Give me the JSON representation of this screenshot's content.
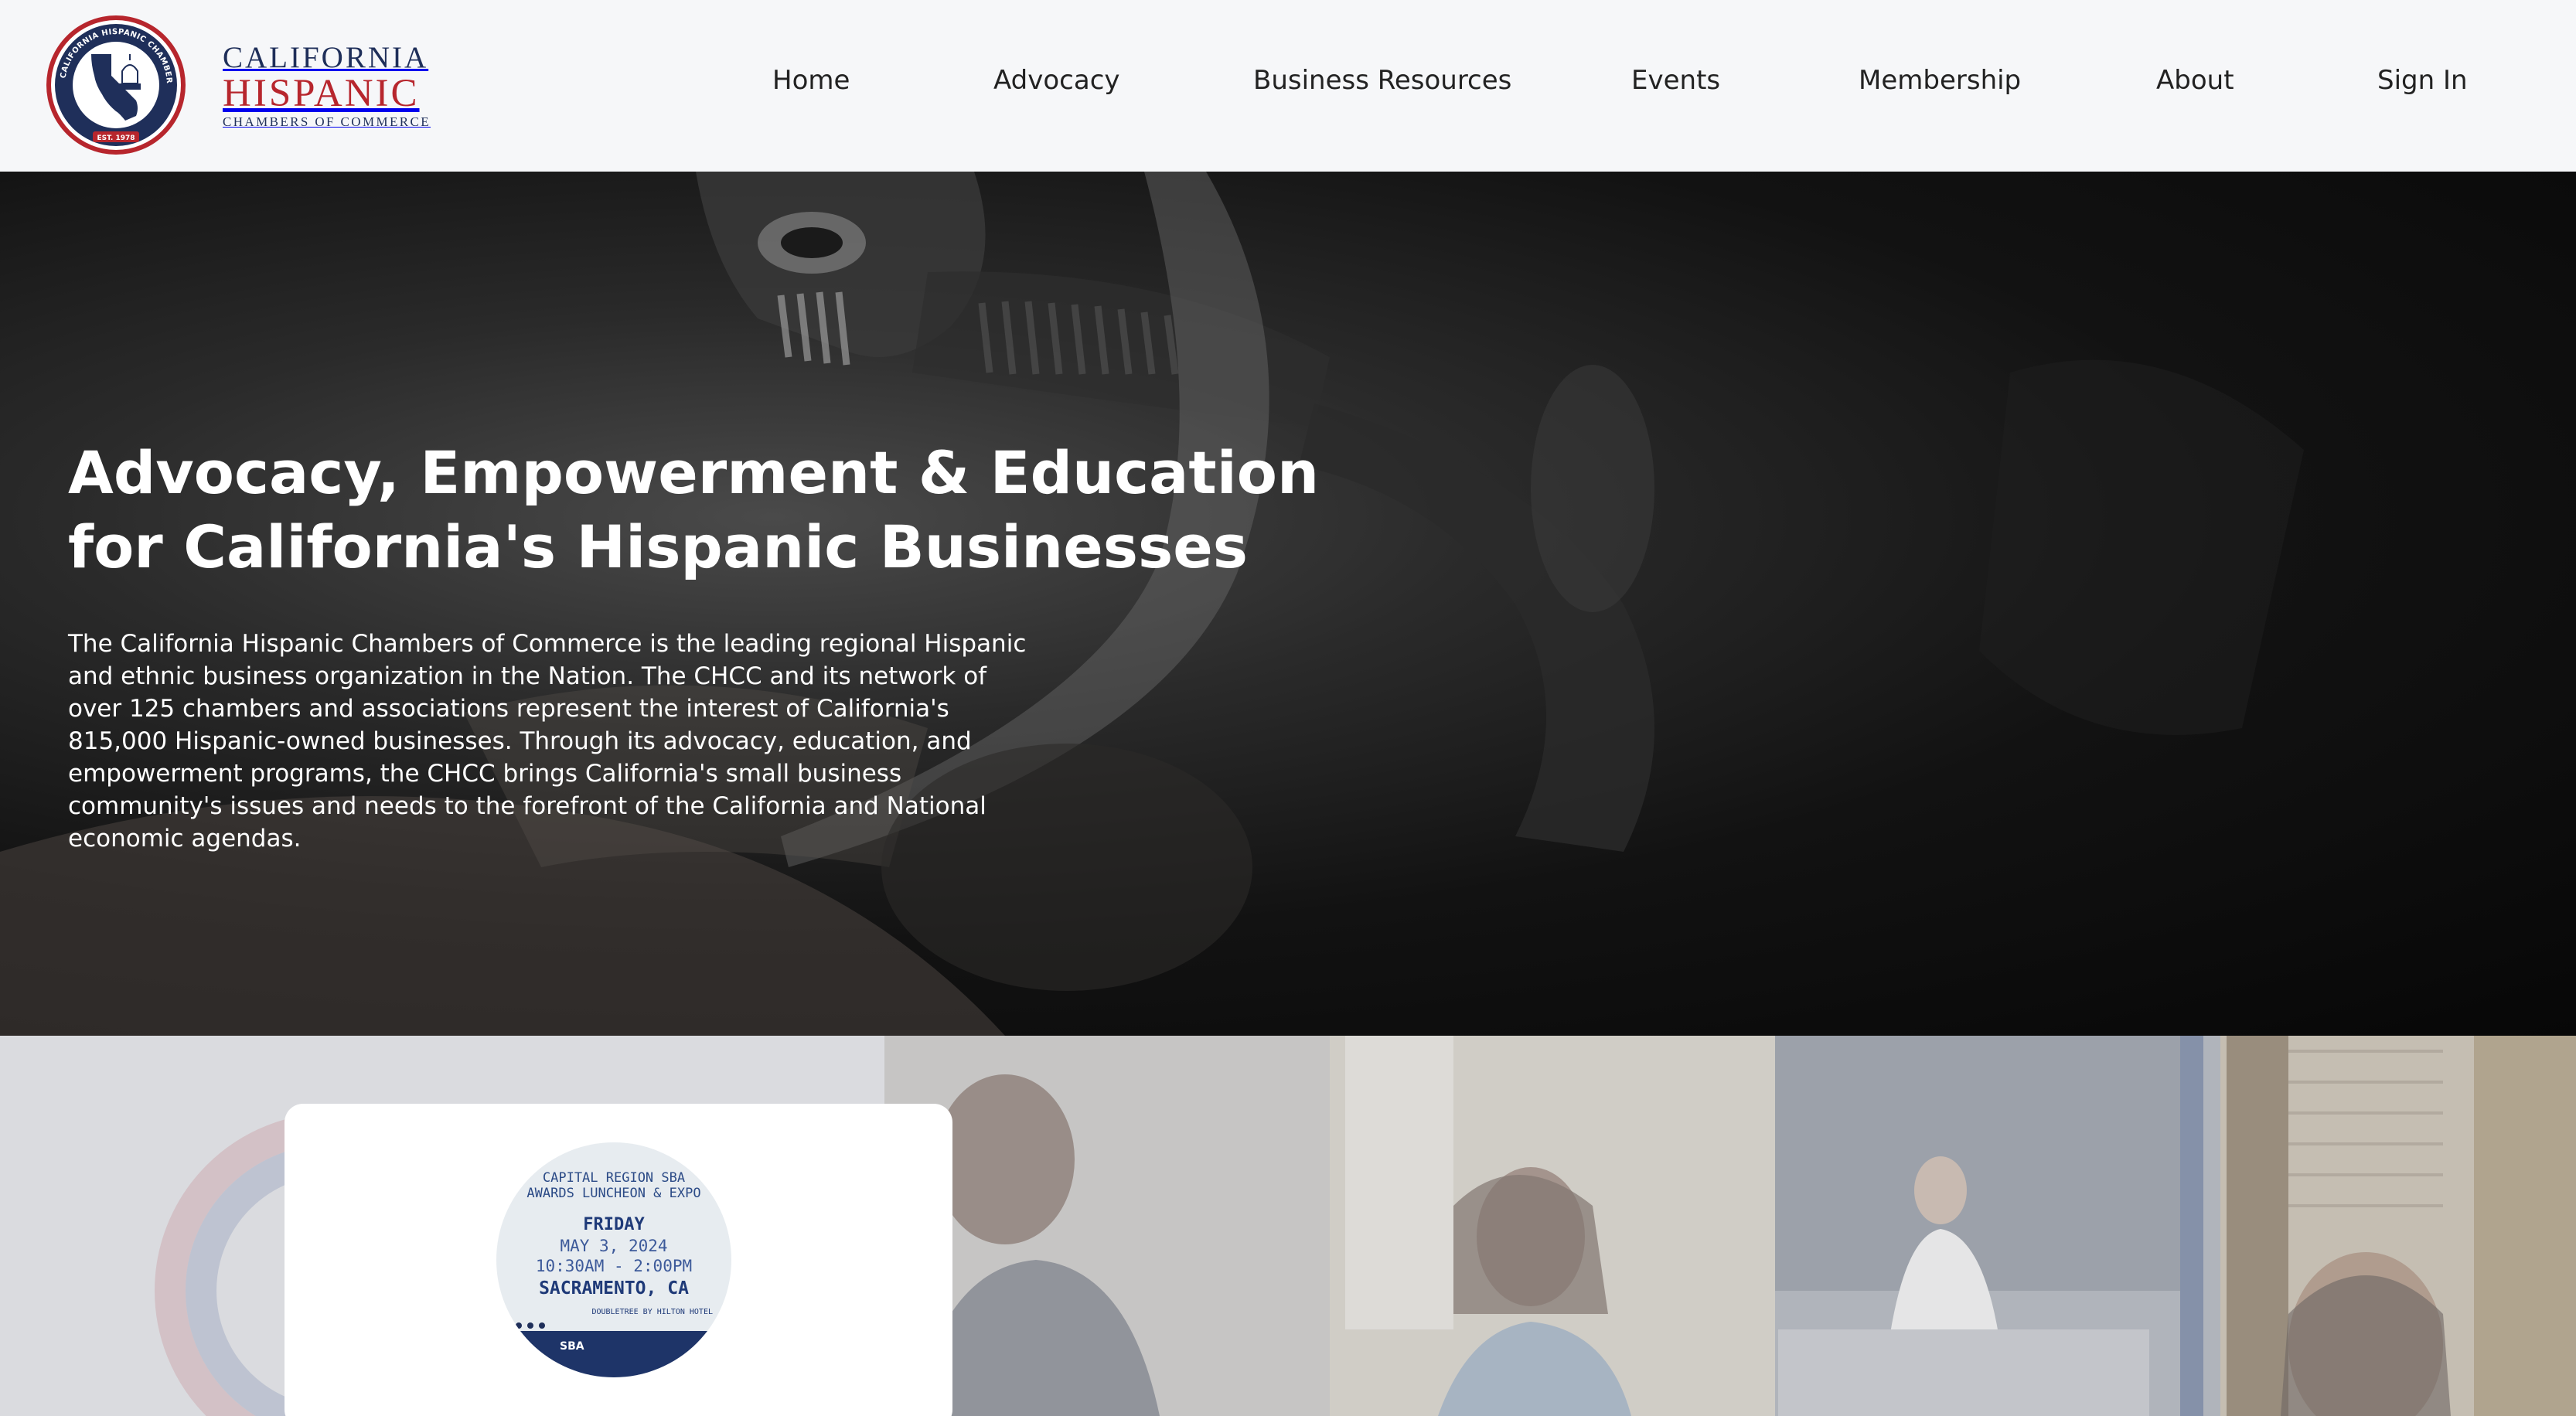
{
  "header": {
    "logo": {
      "line1": "CALIFORNIA",
      "line2": "HISPANIC",
      "line3": "CHAMBERS OF COMMERCE",
      "seal_text": "CALIFORNIA HISPANIC CHAMBERS OF COMMERCE",
      "seal_est": "EST. 1978"
    },
    "nav": [
      {
        "label": "Home"
      },
      {
        "label": "Advocacy"
      },
      {
        "label": "Business Resources"
      },
      {
        "label": "Events"
      },
      {
        "label": "Membership"
      },
      {
        "label": "About"
      },
      {
        "label": "Sign In"
      }
    ]
  },
  "hero": {
    "title": "Advocacy, Empowerment & Education for California's Hispanic Businesses",
    "body": "The California Hispanic Chambers of Commerce is the leading regional Hispanic and ethnic business organization in the Nation. The CHCC and its network of over 125 chambers and associations represent the interest of California's 815,000 Hispanic-owned businesses. Through its advocacy, education, and empowerment programs, the CHCC brings California's small business community's issues and needs to the forefront of the California and National economic agendas."
  },
  "event_card": {
    "flyer": {
      "line1": "CAPITAL REGION SBA",
      "line2": "AWARDS LUNCHEON & EXPO",
      "day": "FRIDAY",
      "date": "MAY 3, 2024",
      "time": "10:30AM - 2:00PM",
      "city": "SACRAMENTO, CA",
      "venue": "DOUBLETREE BY HILTON HOTEL",
      "badge": "SBA"
    }
  },
  "colors": {
    "brand_navy": "#1f2f5a",
    "brand_red": "#b7262d",
    "header_bg": "#f6f7f9",
    "hero_text": "#ffffff"
  }
}
